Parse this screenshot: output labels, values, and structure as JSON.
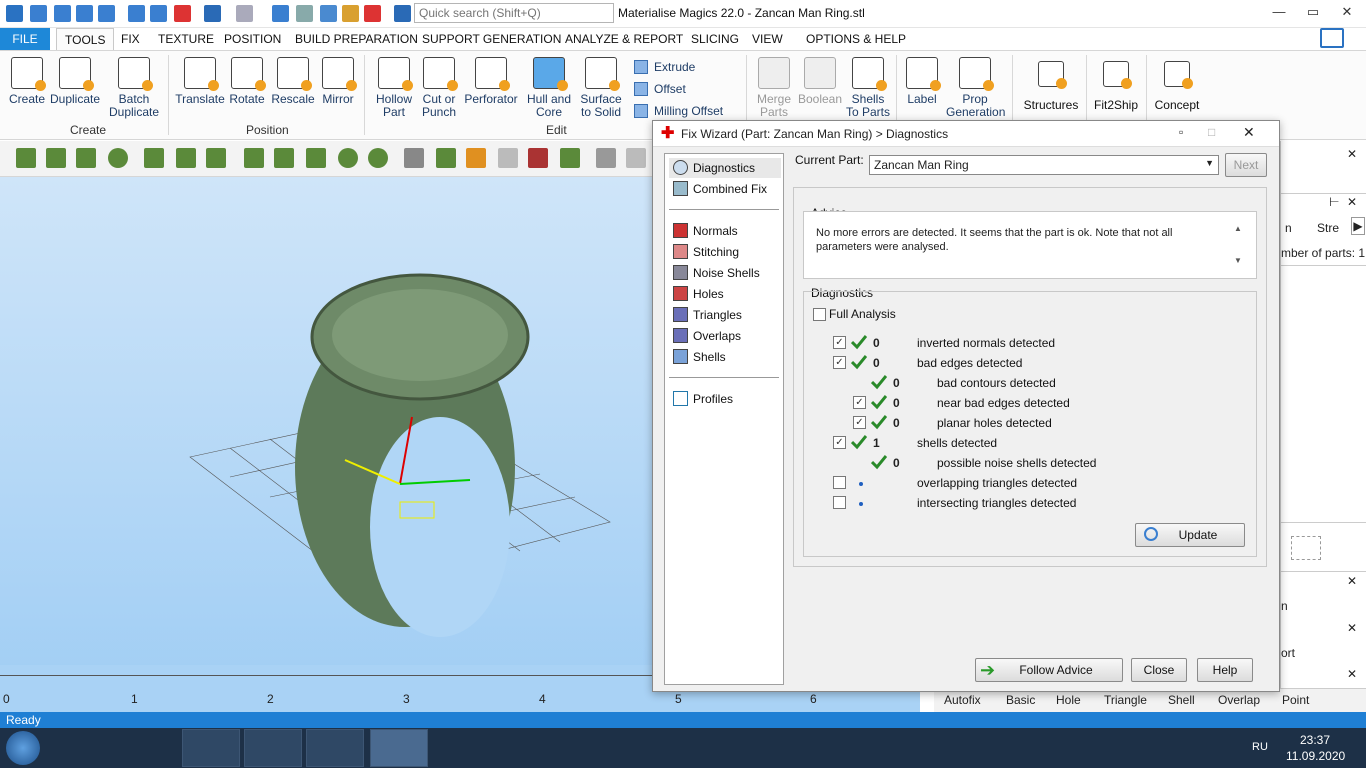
{
  "app": {
    "title": "Materialise Magics 22.0 - Zancan Man Ring.stl",
    "search_placeholder": "Quick search (Shift+Q)"
  },
  "menu": [
    "FILE",
    "TOOLS",
    "FIX",
    "TEXTURE",
    "POSITION",
    "BUILD PREPARATION",
    "SUPPORT GENERATION",
    "ANALYZE & REPORT",
    "SLICING",
    "VIEW",
    "OPTIONS & HELP"
  ],
  "ribbon": {
    "create": {
      "buttons": [
        "Create",
        "Duplicate",
        "Batch\nDuplicate"
      ],
      "group": "Create"
    },
    "position": {
      "buttons": [
        "Translate",
        "Rotate",
        "Rescale",
        "Mirror"
      ],
      "group": "Position"
    },
    "edit": {
      "buttons": [
        "Hollow\nPart",
        "Cut or\nPunch",
        "Perforator",
        "Hull and\nCore",
        "Surface\nto Solid"
      ],
      "small": [
        "Extrude",
        "Offset",
        "Milling Offset"
      ],
      "group": "Edit"
    },
    "other": [
      "Merge\nParts",
      "Boolean",
      "Shells\nTo Parts",
      "Label",
      "Prop\nGeneration",
      "Structures",
      "Fit2Ship",
      "Concept"
    ]
  },
  "dialog": {
    "title": "Fix Wizard (Part: Zancan Man Ring) > Diagnostics",
    "nav": {
      "top": [
        "Diagnostics",
        "Combined Fix"
      ],
      "middle": [
        "Normals",
        "Stitching",
        "Noise Shells",
        "Holes",
        "Triangles",
        "Overlaps",
        "Shells"
      ],
      "bottom": [
        "Profiles"
      ]
    },
    "current_part_label": "Current Part:",
    "current_part": "Zancan Man Ring",
    "next": "Next",
    "advice_title": "Advice",
    "advice_text": "No more errors are detected. It seems that the part is ok. Note that not all parameters were analysed.",
    "diagnostics_title": "Diagnostics",
    "full_analysis": "Full Analysis",
    "rows": [
      {
        "count": "0",
        "label": "inverted normals detected"
      },
      {
        "count": "0",
        "label": "bad edges detected"
      },
      {
        "count": "0",
        "label": "bad contours detected"
      },
      {
        "count": "0",
        "label": "near bad edges detected"
      },
      {
        "count": "0",
        "label": "planar holes detected"
      },
      {
        "count": "1",
        "label": "shells detected"
      },
      {
        "count": "0",
        "label": "possible noise shells detected"
      },
      {
        "count": "",
        "label": "overlapping triangles detected"
      },
      {
        "count": "",
        "label": "intersecting triangles detected"
      }
    ],
    "update": "Update",
    "follow_advice": "Follow Advice",
    "close": "Close",
    "help": "Help"
  },
  "right_panel": {
    "col_a": "n",
    "col_b": "Stre",
    "parts": "mber of parts:  1",
    "t1": "n",
    "t2": "ort"
  },
  "bottom_tabs": [
    "Autofix",
    "Basic",
    "Hole",
    "Triangle",
    "Shell",
    "Overlap",
    "Point"
  ],
  "ruler": [
    "0",
    "1",
    "2",
    "3",
    "4",
    "5",
    "6"
  ],
  "status": "Ready",
  "taskbar": {
    "time": "23:37",
    "date": "11.09.2020",
    "lang": "RU"
  },
  "colors": {
    "accent": "#1e88d8",
    "check": "#2a8a2a"
  }
}
